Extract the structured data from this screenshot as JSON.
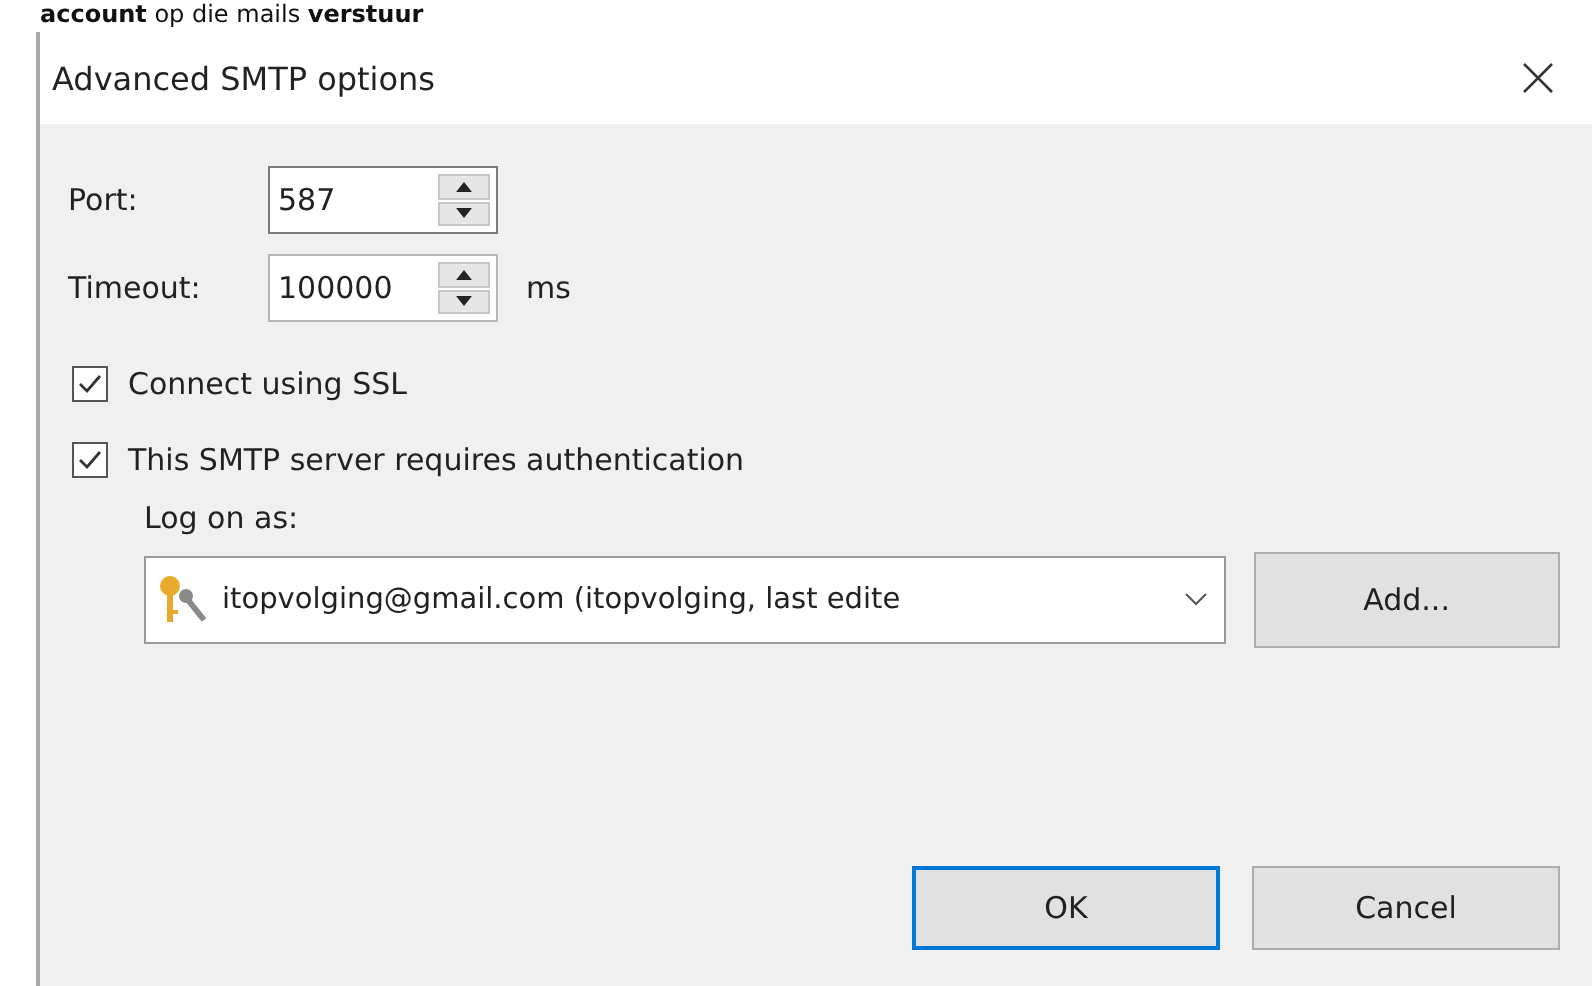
{
  "page_text": "**account** op die mails **verstuur**",
  "window": {
    "title": "Advanced SMTP options"
  },
  "fields": [
    {
      "label": "Port:",
      "value": "587",
      "focused": true
    },
    {
      "label": "Timeout:",
      "value": "100000",
      "focused": false,
      "unit": "ms"
    }
  ],
  "options": [
    {
      "label": "Connect using SSL",
      "checked": true
    },
    {
      "label": "This SMTP server requires authentication",
      "checked": true
    }
  ],
  "logon": {
    "label": "Log on as:",
    "value": "itopvolging@gmail.com (itopvolging, last edite",
    "add_button": "Add..."
  },
  "buttons": [
    {
      "label": "OK",
      "default": true
    },
    {
      "label": "Cancel",
      "default": false
    }
  ]
}
